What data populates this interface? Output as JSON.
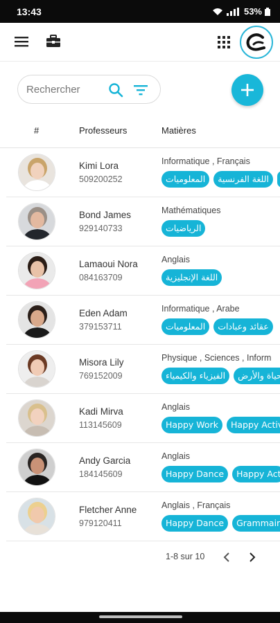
{
  "status": {
    "time": "13:43",
    "battery": "53%"
  },
  "search": {
    "placeholder": "Rechercher"
  },
  "table": {
    "headers": {
      "hash": "#",
      "professors": "Professeurs",
      "subjects": "Matières"
    },
    "rows": [
      {
        "name": "Kimi Lora",
        "phone": "509200252",
        "subjects": "Informatique , Français",
        "chips": [
          "المعلوميات",
          "اللغة الفرنسية",
          "ا"
        ],
        "avatar": "female-blonde"
      },
      {
        "name": "Bond James",
        "phone": "929140733",
        "subjects": "Mathématiques",
        "chips": [
          "الرياضيات"
        ],
        "avatar": "male-suit"
      },
      {
        "name": "Lamaoui Nora",
        "phone": "084163709",
        "subjects": "Anglais",
        "chips": [
          "اللغة الإنجليزية"
        ],
        "avatar": "female-dark"
      },
      {
        "name": "Eden Adam",
        "phone": "379153711",
        "subjects": "Informatique , Arabe",
        "chips": [
          "المعلوميات",
          "عقائد وعبادات"
        ],
        "avatar": "male-young"
      },
      {
        "name": "Misora Lily",
        "phone": "769152009",
        "subjects": "Physique , Sciences , Inform",
        "chips": [
          "الفيزياء والكيمياء",
          "علوم الحياة والأرض"
        ],
        "avatar": "female-glasses"
      },
      {
        "name": "Kadi Mirva",
        "phone": "113145609",
        "subjects": "Anglais",
        "chips": [
          "Happy Work",
          "Happy Activ"
        ],
        "avatar": "female-blonde2"
      },
      {
        "name": "Andy Garcia",
        "phone": "184145609",
        "subjects": "Anglais",
        "chips": [
          "Happy Dance",
          "Happy Act"
        ],
        "avatar": "male-tux"
      },
      {
        "name": "Fletcher Anne",
        "phone": "979120411",
        "subjects": "Anglais , Français",
        "chips": [
          "Happy Dance",
          "Grammaire"
        ],
        "avatar": "female-smile"
      }
    ]
  },
  "pagination": {
    "info": "1-8 sur 10"
  },
  "colors": {
    "accent": "#16b4d7",
    "statusbar": "#0b0b0b"
  },
  "icons": [
    "menu-icon",
    "briefcase-icon",
    "apps-grid-icon",
    "logo-icon",
    "search-icon",
    "filter-icon",
    "plus-icon",
    "chevron-left-icon",
    "chevron-right-icon"
  ]
}
